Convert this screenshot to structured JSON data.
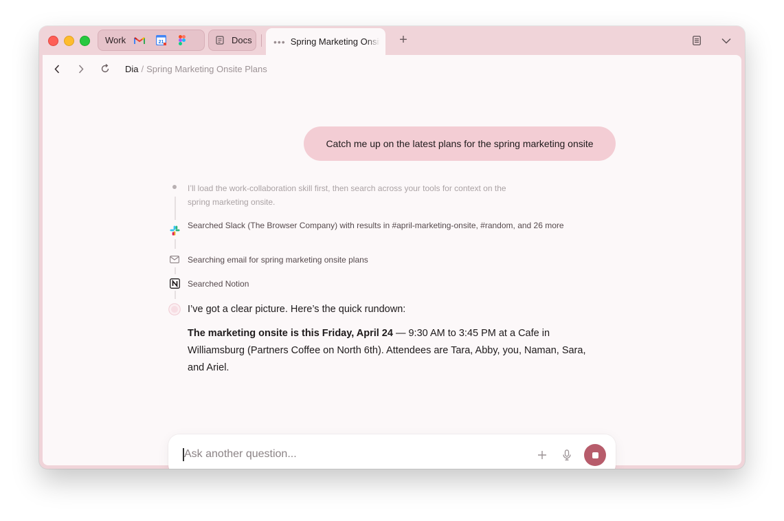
{
  "tabs": {
    "work_group": {
      "label": "Work",
      "icons": [
        "gmail-icon",
        "calendar-icon",
        "figma-icon"
      ],
      "calendar_day": "21"
    },
    "docs_group": {
      "label": "Docs"
    },
    "active_tab": {
      "title": "Spring Marketing Onsite"
    }
  },
  "breadcrumb": {
    "root": "Dia",
    "separator": "/",
    "page": "Spring Marketing Onsite Plans"
  },
  "chat": {
    "user_message": "Catch me up on the latest plans for the spring marketing onsite",
    "steps": [
      {
        "icon": "dot-icon",
        "text": "I’ll load the work-collaboration skill first, then search across your tools for context on the spring marketing onsite."
      },
      {
        "icon": "slack-icon",
        "text": "Searched Slack (The Browser Company) with results in #april-marketing-onsite, #random, and 26 more"
      },
      {
        "icon": "mail-icon",
        "text": "Searching email for spring marketing onsite plans"
      },
      {
        "icon": "notion-icon",
        "text": "Searched Notion"
      }
    ],
    "answer": {
      "intro": "I’ve got a clear picture. Here’s the quick rundown:",
      "bold": "The marketing onsite is this Friday, April 24",
      "rest": " — 9:30 AM to 3:45 PM at a Cafe in Williamsburg (Partners Coffee on North 6th). Attendees are Tara, Abby, you, Naman, Sara, and Ariel."
    }
  },
  "composer": {
    "placeholder": "Ask another question..."
  },
  "colors": {
    "accent": "#b75c6b",
    "chrome": "#f0d4d9",
    "bubble": "#f3cdd4"
  }
}
